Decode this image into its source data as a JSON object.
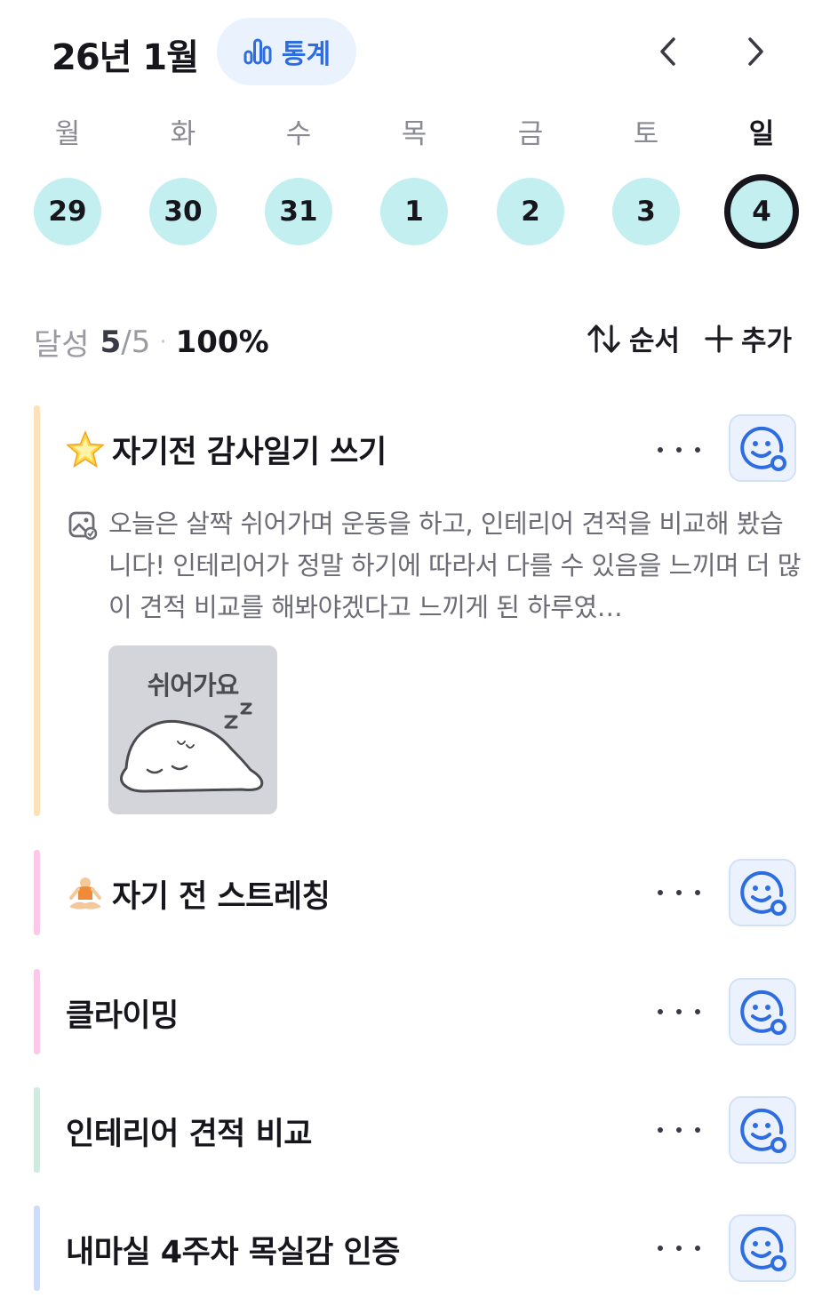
{
  "header": {
    "title": "26년 1월",
    "stats_label": "통계"
  },
  "week": {
    "days": [
      {
        "label": "월",
        "date": "29"
      },
      {
        "label": "화",
        "date": "30"
      },
      {
        "label": "수",
        "date": "31"
      },
      {
        "label": "목",
        "date": "1"
      },
      {
        "label": "금",
        "date": "2"
      },
      {
        "label": "토",
        "date": "3"
      },
      {
        "label": "일",
        "date": "4"
      }
    ],
    "selected": "4"
  },
  "summary": {
    "label": "달성",
    "done": "5",
    "total": "/5",
    "separator": "·",
    "percent": "100%"
  },
  "actions": {
    "order_label": "순서",
    "add_label": "추가"
  },
  "habits": [
    {
      "title": "자기전 감사일기 쓰기",
      "emoji": "star-icon",
      "bar_color": "#fde1b9",
      "memo": "오늘은 살짝 쉬어가며 운동을 하고, 인테리어 견적을 비교해 봤습니다! 인테리어가 정말 하기에 따라서 다를 수 있음을 느끼며 더 많이 견적 비교를 해봐야겠다고 느끼게 된 하루였…",
      "sticker_text": "쉬어가요"
    },
    {
      "title": "자기 전 스트레칭",
      "emoji": "meditation-icon",
      "bar_color": "#fbc9e7"
    },
    {
      "title": "클라이밍",
      "bar_color": "#fbc9e7"
    },
    {
      "title": "인테리어 견적 비교",
      "bar_color": "#cfeadf"
    },
    {
      "title": "내마실 4주차 목실감 인증",
      "bar_color": "#cfdcf8"
    }
  ]
}
